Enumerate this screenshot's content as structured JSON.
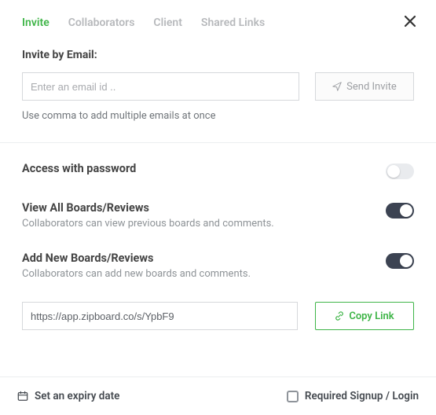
{
  "tabs": {
    "invite": "Invite",
    "collaborators": "Collaborators",
    "client": "Client",
    "shared_links": "Shared Links"
  },
  "invite": {
    "label": "Invite by Email:",
    "placeholder": "Enter an email id ..",
    "send_label": "Send Invite",
    "hint": "Use comma to add multiple emails at once"
  },
  "settings": {
    "password": {
      "title": "Access with password",
      "on": false
    },
    "view_all": {
      "title": "View All Boards/Reviews",
      "sub": "Collaborators can view previous boards and comments.",
      "on": true
    },
    "add_new": {
      "title": "Add New Boards/Reviews",
      "sub": "Collaborators can add new boards and comments.",
      "on": true
    }
  },
  "share": {
    "link": "https://app.zipboard.co/s/YpbF9",
    "copy_label": "Copy Link"
  },
  "footer": {
    "expiry": "Set an expiry date",
    "signup": "Required Signup / Login"
  }
}
